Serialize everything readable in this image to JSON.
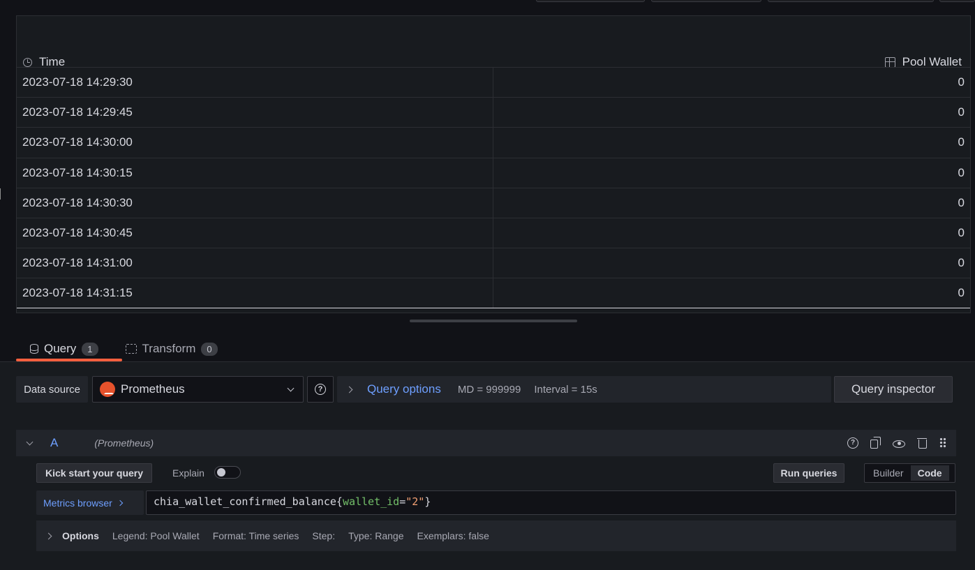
{
  "table": {
    "columns": [
      {
        "label": "Time",
        "icon": "clock-icon"
      },
      {
        "label": "Pool Wallet",
        "icon": "grid-icon"
      }
    ],
    "rows": [
      {
        "time": "2023-07-18 14:29:30",
        "value": "0"
      },
      {
        "time": "2023-07-18 14:29:45",
        "value": "0"
      },
      {
        "time": "2023-07-18 14:30:00",
        "value": "0"
      },
      {
        "time": "2023-07-18 14:30:15",
        "value": "0"
      },
      {
        "time": "2023-07-18 14:30:30",
        "value": "0"
      },
      {
        "time": "2023-07-18 14:30:45",
        "value": "0"
      },
      {
        "time": "2023-07-18 14:31:00",
        "value": "0"
      },
      {
        "time": "2023-07-18 14:31:15",
        "value": "0"
      }
    ]
  },
  "tabs": [
    {
      "label": "Query",
      "count": "1",
      "active": true
    },
    {
      "label": "Transform",
      "count": "0",
      "active": false
    }
  ],
  "datasource": {
    "label": "Data source",
    "selected": "Prometheus"
  },
  "query_options": {
    "label": "Query options",
    "md": "MD = 999999",
    "interval": "Interval = 15s"
  },
  "query_inspector_label": "Query inspector",
  "query_row": {
    "ref_id": "A",
    "datasource_name": "(Prometheus)",
    "kick_start_label": "Kick start your query",
    "explain_label": "Explain",
    "explain_enabled": false,
    "run_queries_label": "Run queries",
    "mode_options": [
      "Builder",
      "Code"
    ],
    "mode_selected": "Code",
    "metrics_browser_label": "Metrics browser",
    "query": {
      "metric": "chia_wallet_confirmed_balance",
      "open": "{",
      "label_name": "wallet_id",
      "op": "=",
      "label_value": "\"2\"",
      "close": "}"
    },
    "options": {
      "title": "Options",
      "legend": "Legend: Pool Wallet",
      "format": "Format: Time series",
      "step": "Step:",
      "type": "Type: Range",
      "exemplars": "Exemplars: false"
    }
  },
  "colors": {
    "accent_tab": "#f55f3e",
    "link_blue": "#6e9fff",
    "prometheus": "#e6522c",
    "label_green": "#73bf69",
    "string_orange": "#f2a074"
  }
}
